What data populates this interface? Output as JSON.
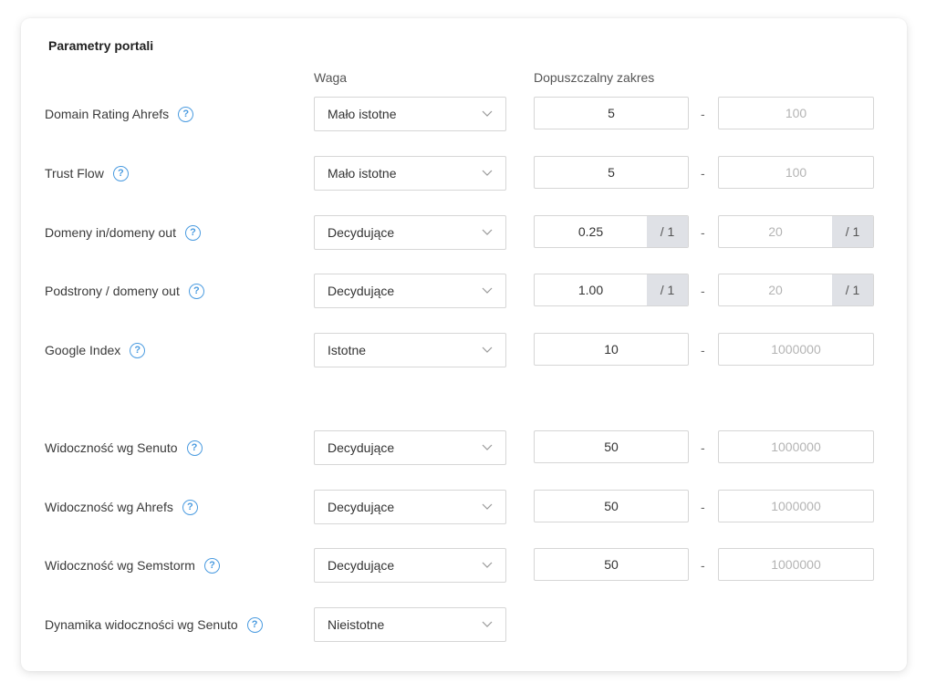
{
  "card": {
    "title": "Parametry portali",
    "weight_header": "Waga",
    "range_header": "Dopuszczalny zakres"
  },
  "rows": [
    {
      "label": "Domain Rating Ahrefs",
      "weight": "Mało istotne",
      "min": "5",
      "max": "100"
    },
    {
      "label": "Trust Flow",
      "weight": "Mało istotne",
      "min": "5",
      "max": "100"
    },
    {
      "label": "Domeny in/domeny out",
      "weight": "Decydujące",
      "min": "0.25",
      "min_suffix": "/ 1",
      "max": "20",
      "max_suffix": "/ 1"
    },
    {
      "label": "Podstrony / domeny out",
      "weight": "Decydujące",
      "min": "1.00",
      "min_suffix": "/ 1",
      "max": "20",
      "max_suffix": "/ 1"
    },
    {
      "label": "Google Index",
      "weight": "Istotne",
      "min": "10",
      "max": "1000000"
    },
    {
      "label": "Widoczność wg Senuto",
      "weight": "Decydujące",
      "min": "50",
      "max": "1000000"
    },
    {
      "label": "Widoczność wg Ahrefs",
      "weight": "Decydujące",
      "min": "50",
      "max": "1000000"
    },
    {
      "label": "Widoczność wg Semstorm",
      "weight": "Decydujące",
      "min": "50",
      "max": "1000000"
    },
    {
      "label": "Dynamika widoczności wg Senuto",
      "weight": "Nieistotne"
    }
  ],
  "range_separator": "-",
  "help_icon_glyph": "?",
  "icons": {
    "help": "question-circle-icon",
    "dropdown": "chevron-down-icon"
  },
  "colors": {
    "accent": "#4a9be0",
    "suffix_bg": "#dfe1e6",
    "border": "#d6d6d6"
  }
}
